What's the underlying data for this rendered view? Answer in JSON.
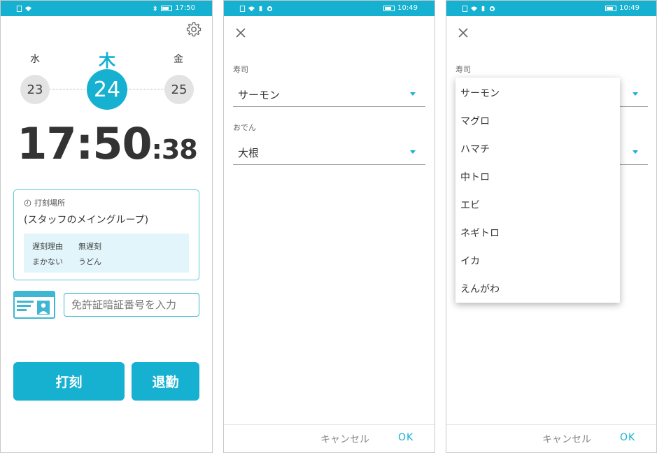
{
  "screen1": {
    "status_time": "17:50",
    "days": {
      "prev": {
        "dow": "水",
        "date": "23"
      },
      "current": {
        "dow": "木",
        "date": "24"
      },
      "next": {
        "dow": "金",
        "date": "25"
      }
    },
    "clock": {
      "hm": "17:50",
      "sec": ":38"
    },
    "place": {
      "label": "打刻場所",
      "name": "(スタッフのメイングループ)",
      "rows": [
        {
          "key": "遅刻理由",
          "value": "無遅刻"
        },
        {
          "key": "まかない",
          "value": "うどん"
        }
      ]
    },
    "license_input": {
      "placeholder": "免許証暗証番号を入力"
    },
    "buttons": {
      "stamp": "打刻",
      "leave": "退勤"
    }
  },
  "screen2": {
    "status_time": "10:49",
    "fields": [
      {
        "label": "寿司",
        "value": "サーモン"
      },
      {
        "label": "おでん",
        "value": "大根"
      }
    ],
    "footer": {
      "cancel": "キャンセル",
      "ok": "OK"
    }
  },
  "screen3": {
    "status_time": "10:49",
    "field_label": "寿司",
    "options": [
      "サーモン",
      "マグロ",
      "ハマチ",
      "中トロ",
      "エビ",
      "ネギトロ",
      "イカ",
      "えんがわ"
    ],
    "footer": {
      "cancel": "キャンセル",
      "ok": "OK"
    }
  },
  "colors": {
    "accent": "#16b1d1",
    "day_inactive": "#e3e3e3",
    "info_box": "#e2f5fa"
  }
}
